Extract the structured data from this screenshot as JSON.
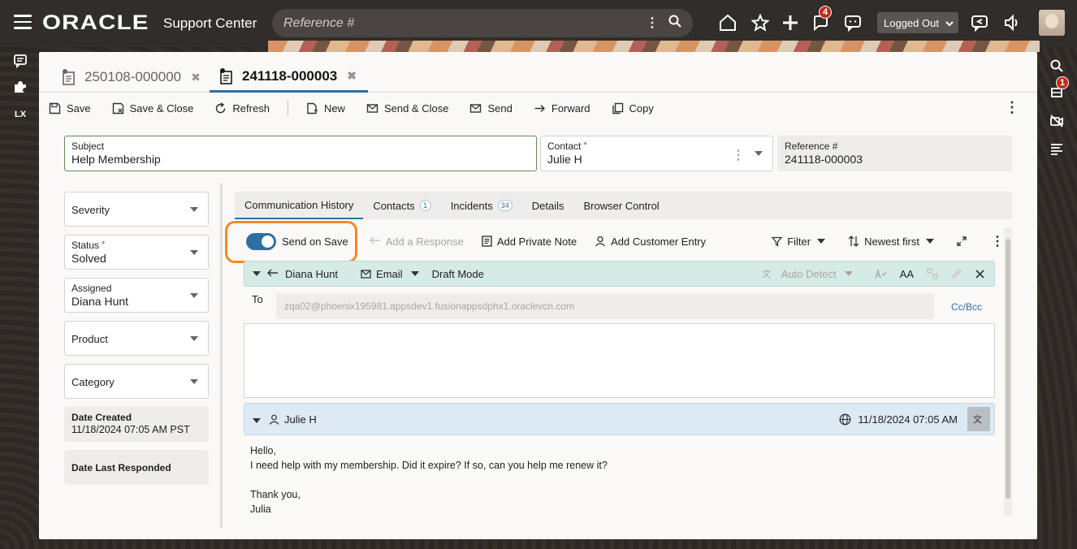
{
  "topbar": {
    "brand": "ORACLE",
    "product": "Support Center",
    "search_placeholder": "Reference #",
    "notifications_count": "4",
    "status": "Logged Out"
  },
  "right_rail": {
    "badge_count": "1"
  },
  "left_rail": {
    "lx_label": "LX"
  },
  "tabs": [
    {
      "label": "250108-000000",
      "active": false
    },
    {
      "label": "241118-000003",
      "active": true
    }
  ],
  "toolbar": {
    "save": "Save",
    "save_close": "Save & Close",
    "refresh": "Refresh",
    "new": "New",
    "send_close": "Send & Close",
    "send": "Send",
    "forward": "Forward",
    "copy": "Copy"
  },
  "header_fields": {
    "subject_label": "Subject",
    "subject_value": "Help Membership",
    "contact_label": "Contact",
    "contact_value": "Julie H",
    "reference_label": "Reference #",
    "reference_value": "241118-000003"
  },
  "side_fields": {
    "severity_label": "Severity",
    "status_label": "Status",
    "status_value": "Solved",
    "assigned_label": "Assigned",
    "assigned_value": "Diana Hunt",
    "product_label": "Product",
    "category_label": "Category",
    "date_created_label": "Date Created",
    "date_created_value": "11/18/2024 07:05 AM PST",
    "date_last_responded_label": "Date Last Responded"
  },
  "subtabs": {
    "communication_history": "Communication History",
    "contacts": "Contacts",
    "contacts_count": "1",
    "incidents": "Incidents",
    "incidents_count": "34",
    "details": "Details",
    "browser_control": "Browser Control"
  },
  "comm_toolbar": {
    "send_on_save": "Send on Save",
    "add_response": "Add a Response",
    "add_private_note": "Add Private Note",
    "add_customer_entry": "Add Customer Entry",
    "filter": "Filter",
    "sort": "Newest first"
  },
  "compose": {
    "author": "Diana Hunt",
    "channel": "Email",
    "mode": "Draft Mode",
    "auto_detect": "Auto Detect",
    "font_size_label": "AA",
    "to_label": "To",
    "to_value": "zqa02@phoenix195981.appsdev1.fusionappsdphx1.oraclevcn.com",
    "cc_bcc": "Cc/Bcc"
  },
  "message": {
    "author": "Julie H",
    "timestamp": "11/18/2024 07:05 AM",
    "line1": "Hello,",
    "line2": "I need help with my membership. Did it expire? If so, can you help me renew it?",
    "line3": "Thank you,",
    "line4": "Julia"
  }
}
